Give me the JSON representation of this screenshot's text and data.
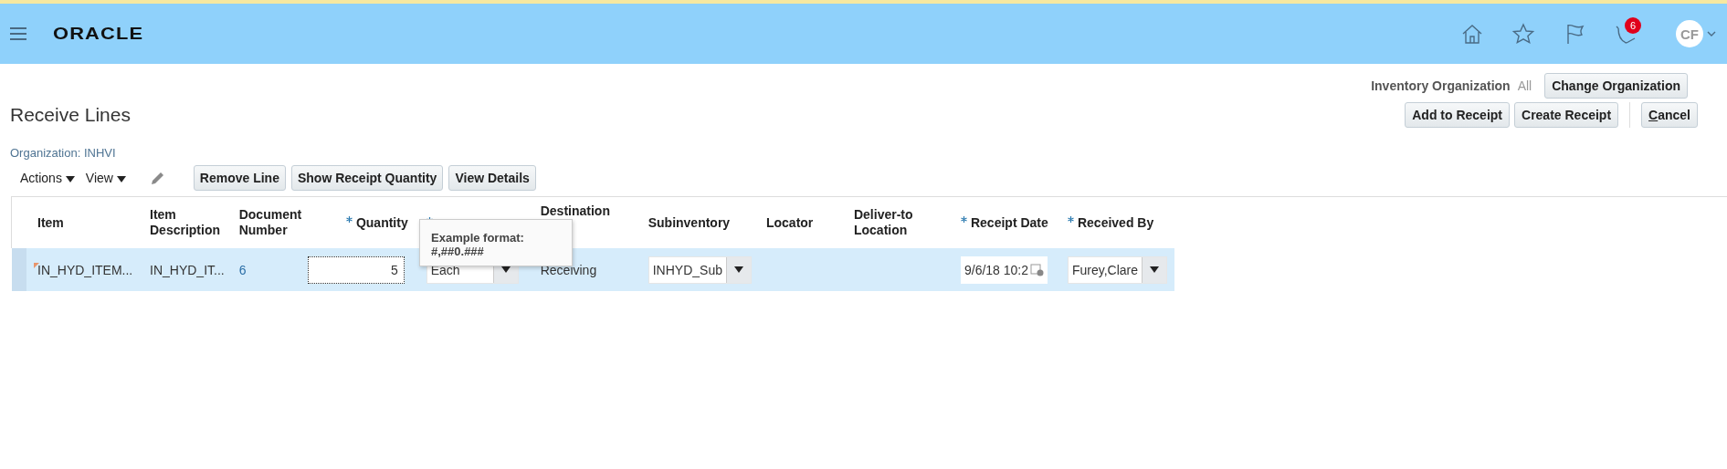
{
  "header": {
    "logo": "ORACLE",
    "notifications_count": "6",
    "user_initials": "CF"
  },
  "org_bar": {
    "label": "Inventory Organization",
    "value": "All",
    "button": "Change Organization"
  },
  "page": {
    "title": "Receive Lines",
    "actions": [
      {
        "label": "Add to Receipt",
        "mnemonic": false
      },
      {
        "label": "Create Receipt",
        "mnemonic": false
      },
      {
        "label": "Cancel",
        "mnemonic": true
      }
    ]
  },
  "organization": "Organization: INHVI",
  "toolbar": {
    "menus": [
      "Actions",
      "View"
    ],
    "buttons": [
      "Remove Line",
      "Show Receipt Quantity",
      "View Details"
    ]
  },
  "table": {
    "columns": [
      {
        "label": "Item",
        "required": false
      },
      {
        "label": "Item Description",
        "required": false
      },
      {
        "label": "Document Number",
        "required": false
      },
      {
        "label": "Quantity",
        "required": true
      },
      {
        "required": true
      },
      {
        "label": "Destination",
        "required": false
      },
      {
        "label": "Subinventory",
        "required": false
      },
      {
        "label": "Locator",
        "required": false
      },
      {
        "label": "Deliver-to Location",
        "required": false
      },
      {
        "label": "Receipt Date",
        "required": true
      },
      {
        "label": "Received By",
        "required": true
      }
    ],
    "rows": [
      {
        "selected": true,
        "cells": [
          {
            "kind": "flagged",
            "text": "IN_HYD_ITEM..."
          },
          {
            "kind": "text",
            "text": "IN_HYD_IT..."
          },
          {
            "kind": "link",
            "text": "6"
          },
          {
            "kind": "number_input",
            "text": "5"
          },
          {
            "kind": "select",
            "text": "Each"
          },
          {
            "kind": "text",
            "text": "Receiving"
          },
          {
            "kind": "select",
            "text": "INHYD_Sub"
          },
          {
            "kind": "empty"
          },
          {
            "kind": "empty"
          },
          {
            "kind": "date",
            "text": "9/6/18 10:2"
          },
          {
            "kind": "select",
            "text": "Furey,Clare"
          }
        ]
      }
    ]
  },
  "tooltip": {
    "title": "Example format:",
    "format": "#,##0.###"
  }
}
